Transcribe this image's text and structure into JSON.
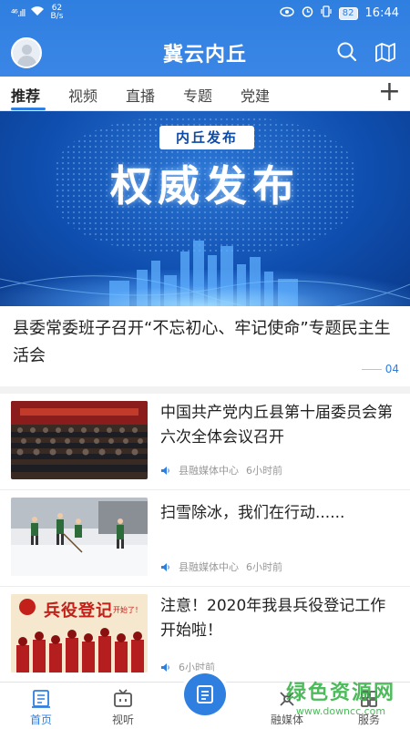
{
  "status_bar": {
    "signal": "⁴⁶.ıll",
    "speed_value": "62",
    "speed_unit": "B/s",
    "battery": "82",
    "time": "16:44"
  },
  "header": {
    "title": "冀云内丘",
    "search_icon": "search-icon",
    "map_icon": "map-icon"
  },
  "tabs": {
    "items": [
      {
        "label": "推荐",
        "active": true
      },
      {
        "label": "视频",
        "active": false
      },
      {
        "label": "直播",
        "active": false
      },
      {
        "label": "专题",
        "active": false
      },
      {
        "label": "党建",
        "active": false
      }
    ],
    "add_label": "+"
  },
  "banner": {
    "tag": "内丘发布",
    "big_text": "权威发布",
    "headline": "县委常委班子召开“不忘初心、牢记使命”专题民主生活会",
    "page_indicator": "04"
  },
  "news": [
    {
      "title": "中国共产党内丘县第十届委员会第六次全体会议召开",
      "source": "县融媒体中心",
      "time": "6小时前"
    },
    {
      "title": "扫雪除冰，我们在行动......",
      "source": "县融媒体中心",
      "time": "6小时前"
    },
    {
      "title": "注意！2020年我县兵役登记工作开始啦！",
      "source": "",
      "time": "6小时前",
      "thumb_text": "兵役登记",
      "thumb_sub": "开始了！"
    }
  ],
  "bottom_nav": {
    "items": [
      {
        "label": "首页",
        "active": true
      },
      {
        "label": "视听",
        "active": false
      },
      {
        "label": "融媒体",
        "active": false
      },
      {
        "label": "服务",
        "active": false
      }
    ]
  },
  "watermark": {
    "main": "绿色资源网",
    "sub": "www.downcc.com"
  },
  "colors": {
    "accent": "#2f7fe0",
    "watermark_green": "#3ab44a"
  }
}
